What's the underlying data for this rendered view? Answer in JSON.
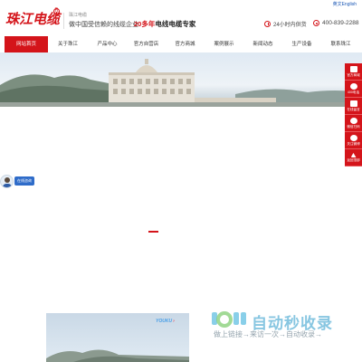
{
  "topbar": {
    "lang_label": "英文English"
  },
  "header": {
    "logo_text": "珠江电缆",
    "logo_reg": "R",
    "slogan_small": "珠江电缆",
    "slogan_main": "做中国受信赖的线缆企业",
    "expert_num": "20多年",
    "expert_text": "电线电缆专家",
    "service_label": "24小时内供货",
    "phone_label": "400-839-2288"
  },
  "nav": {
    "items": [
      {
        "label": "网站首页"
      },
      {
        "label": "关于珠江"
      },
      {
        "label": "产品中心"
      },
      {
        "label": "官方自营店"
      },
      {
        "label": "官方商城"
      },
      {
        "label": "案例展示"
      },
      {
        "label": "新闻动态"
      },
      {
        "label": "生产设备"
      },
      {
        "label": "联系珠江"
      }
    ]
  },
  "float_bar": {
    "items": [
      {
        "label": "官方商城",
        "icon": "store-icon"
      },
      {
        "label": "400电话",
        "icon": "phone-icon"
      },
      {
        "label": "在线留言",
        "icon": "message-icon"
      },
      {
        "label": "微信扫码",
        "icon": "wechat-icon"
      },
      {
        "label": "关注微博",
        "icon": "weibo-icon"
      },
      {
        "label": "返回顶部",
        "icon": "arrow-up-icon"
      }
    ]
  },
  "consult": {
    "label": "在线咨询"
  },
  "video": {
    "brand": "YOUKU",
    "chevron": "›"
  },
  "watermark": {
    "title": "自动秒收录",
    "subtitle": "做上链接→来访一次→自动收录→"
  },
  "colors": {
    "brand_red": "#d4141a",
    "consult_blue": "#2f6cc9",
    "youku_blue": "#4aa0e8"
  }
}
